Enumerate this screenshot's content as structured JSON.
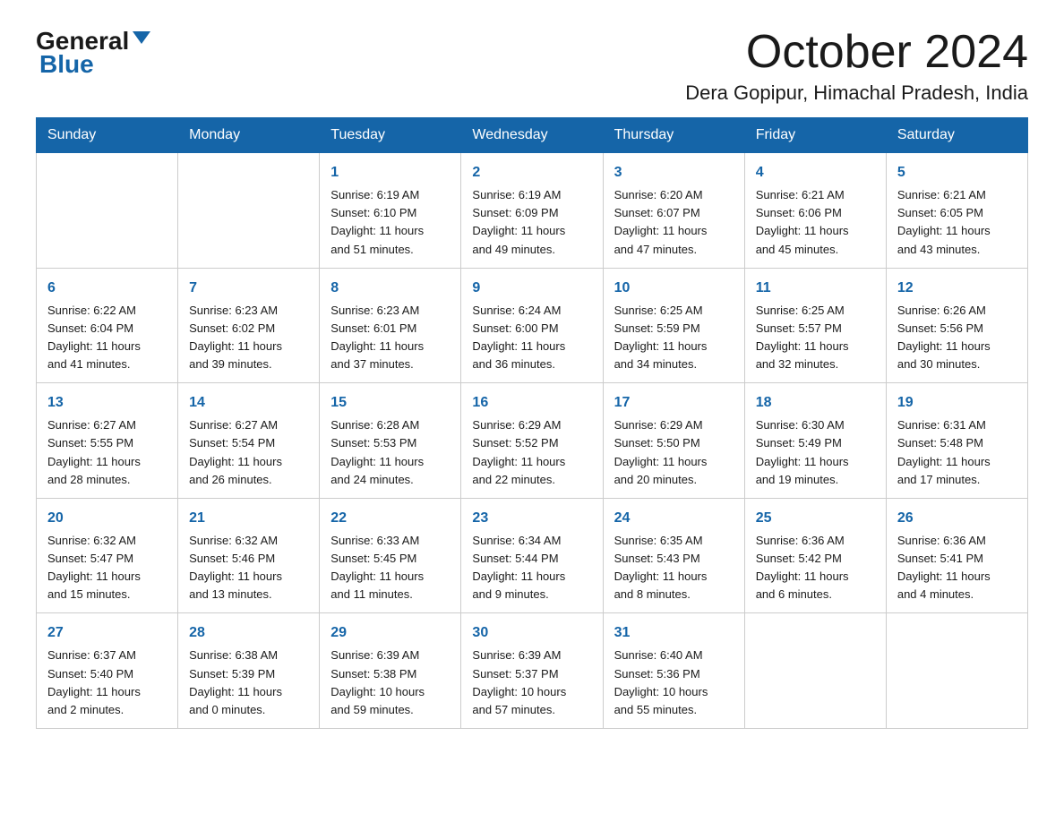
{
  "logo": {
    "general": "General",
    "blue": "Blue"
  },
  "title": "October 2024",
  "location": "Dera Gopipur, Himachal Pradesh, India",
  "days_of_week": [
    "Sunday",
    "Monday",
    "Tuesday",
    "Wednesday",
    "Thursday",
    "Friday",
    "Saturday"
  ],
  "weeks": [
    [
      {
        "day": "",
        "info": ""
      },
      {
        "day": "",
        "info": ""
      },
      {
        "day": "1",
        "info": "Sunrise: 6:19 AM\nSunset: 6:10 PM\nDaylight: 11 hours\nand 51 minutes."
      },
      {
        "day": "2",
        "info": "Sunrise: 6:19 AM\nSunset: 6:09 PM\nDaylight: 11 hours\nand 49 minutes."
      },
      {
        "day": "3",
        "info": "Sunrise: 6:20 AM\nSunset: 6:07 PM\nDaylight: 11 hours\nand 47 minutes."
      },
      {
        "day": "4",
        "info": "Sunrise: 6:21 AM\nSunset: 6:06 PM\nDaylight: 11 hours\nand 45 minutes."
      },
      {
        "day": "5",
        "info": "Sunrise: 6:21 AM\nSunset: 6:05 PM\nDaylight: 11 hours\nand 43 minutes."
      }
    ],
    [
      {
        "day": "6",
        "info": "Sunrise: 6:22 AM\nSunset: 6:04 PM\nDaylight: 11 hours\nand 41 minutes."
      },
      {
        "day": "7",
        "info": "Sunrise: 6:23 AM\nSunset: 6:02 PM\nDaylight: 11 hours\nand 39 minutes."
      },
      {
        "day": "8",
        "info": "Sunrise: 6:23 AM\nSunset: 6:01 PM\nDaylight: 11 hours\nand 37 minutes."
      },
      {
        "day": "9",
        "info": "Sunrise: 6:24 AM\nSunset: 6:00 PM\nDaylight: 11 hours\nand 36 minutes."
      },
      {
        "day": "10",
        "info": "Sunrise: 6:25 AM\nSunset: 5:59 PM\nDaylight: 11 hours\nand 34 minutes."
      },
      {
        "day": "11",
        "info": "Sunrise: 6:25 AM\nSunset: 5:57 PM\nDaylight: 11 hours\nand 32 minutes."
      },
      {
        "day": "12",
        "info": "Sunrise: 6:26 AM\nSunset: 5:56 PM\nDaylight: 11 hours\nand 30 minutes."
      }
    ],
    [
      {
        "day": "13",
        "info": "Sunrise: 6:27 AM\nSunset: 5:55 PM\nDaylight: 11 hours\nand 28 minutes."
      },
      {
        "day": "14",
        "info": "Sunrise: 6:27 AM\nSunset: 5:54 PM\nDaylight: 11 hours\nand 26 minutes."
      },
      {
        "day": "15",
        "info": "Sunrise: 6:28 AM\nSunset: 5:53 PM\nDaylight: 11 hours\nand 24 minutes."
      },
      {
        "day": "16",
        "info": "Sunrise: 6:29 AM\nSunset: 5:52 PM\nDaylight: 11 hours\nand 22 minutes."
      },
      {
        "day": "17",
        "info": "Sunrise: 6:29 AM\nSunset: 5:50 PM\nDaylight: 11 hours\nand 20 minutes."
      },
      {
        "day": "18",
        "info": "Sunrise: 6:30 AM\nSunset: 5:49 PM\nDaylight: 11 hours\nand 19 minutes."
      },
      {
        "day": "19",
        "info": "Sunrise: 6:31 AM\nSunset: 5:48 PM\nDaylight: 11 hours\nand 17 minutes."
      }
    ],
    [
      {
        "day": "20",
        "info": "Sunrise: 6:32 AM\nSunset: 5:47 PM\nDaylight: 11 hours\nand 15 minutes."
      },
      {
        "day": "21",
        "info": "Sunrise: 6:32 AM\nSunset: 5:46 PM\nDaylight: 11 hours\nand 13 minutes."
      },
      {
        "day": "22",
        "info": "Sunrise: 6:33 AM\nSunset: 5:45 PM\nDaylight: 11 hours\nand 11 minutes."
      },
      {
        "day": "23",
        "info": "Sunrise: 6:34 AM\nSunset: 5:44 PM\nDaylight: 11 hours\nand 9 minutes."
      },
      {
        "day": "24",
        "info": "Sunrise: 6:35 AM\nSunset: 5:43 PM\nDaylight: 11 hours\nand 8 minutes."
      },
      {
        "day": "25",
        "info": "Sunrise: 6:36 AM\nSunset: 5:42 PM\nDaylight: 11 hours\nand 6 minutes."
      },
      {
        "day": "26",
        "info": "Sunrise: 6:36 AM\nSunset: 5:41 PM\nDaylight: 11 hours\nand 4 minutes."
      }
    ],
    [
      {
        "day": "27",
        "info": "Sunrise: 6:37 AM\nSunset: 5:40 PM\nDaylight: 11 hours\nand 2 minutes."
      },
      {
        "day": "28",
        "info": "Sunrise: 6:38 AM\nSunset: 5:39 PM\nDaylight: 11 hours\nand 0 minutes."
      },
      {
        "day": "29",
        "info": "Sunrise: 6:39 AM\nSunset: 5:38 PM\nDaylight: 10 hours\nand 59 minutes."
      },
      {
        "day": "30",
        "info": "Sunrise: 6:39 AM\nSunset: 5:37 PM\nDaylight: 10 hours\nand 57 minutes."
      },
      {
        "day": "31",
        "info": "Sunrise: 6:40 AM\nSunset: 5:36 PM\nDaylight: 10 hours\nand 55 minutes."
      },
      {
        "day": "",
        "info": ""
      },
      {
        "day": "",
        "info": ""
      }
    ]
  ]
}
